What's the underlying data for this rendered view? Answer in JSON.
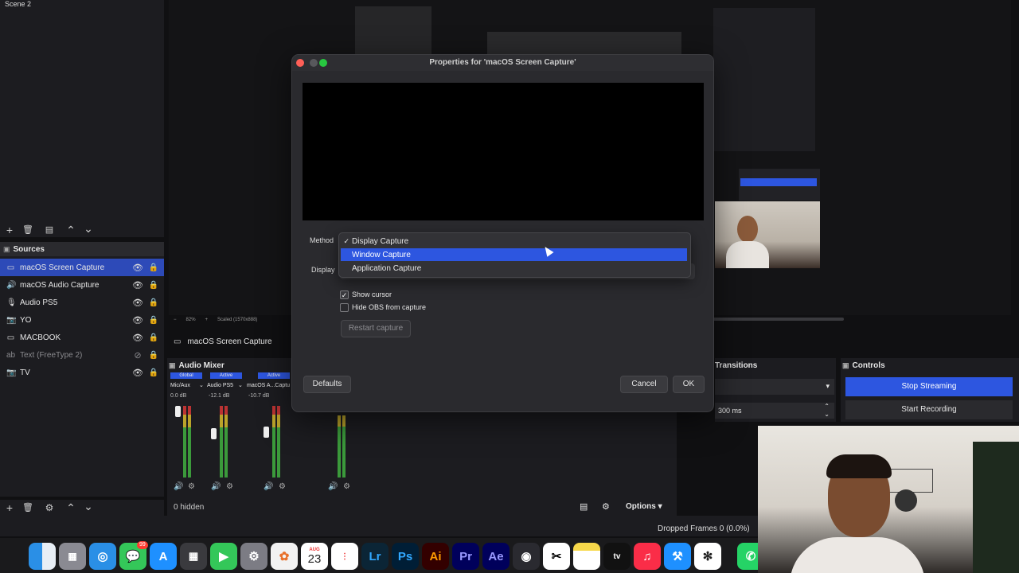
{
  "obs": {
    "scene_label": "Scene 2",
    "sources_title": "Sources",
    "sources": [
      {
        "label": "macOS Screen Capture",
        "icon": "monitor-icon",
        "selected": true
      },
      {
        "label": "macOS Audio Capture",
        "icon": "speaker-icon"
      },
      {
        "label": "Audio PS5",
        "icon": "mic-icon"
      },
      {
        "label": "YO",
        "icon": "camera-icon"
      },
      {
        "label": "MACBOOK",
        "icon": "monitor-icon"
      },
      {
        "label": "Text (FreeType 2)",
        "icon": "text-icon",
        "hidden": true
      },
      {
        "label": "TV",
        "icon": "camera-icon"
      }
    ],
    "preview_zoom": "82%",
    "preview_scale": "Scaled (1570x888)",
    "source_bar_label": "macOS Screen Capture",
    "audio_mixer_title": "Audio Mixer",
    "mixer_channels": [
      {
        "badge": "Global",
        "name": "Mic/Aux",
        "db": "0.0 dB"
      },
      {
        "badge": "Active",
        "name": "Audio PS5",
        "db": "-12.1 dB"
      },
      {
        "badge": "Active",
        "name": "macOS A...Captu",
        "db": "-10.7 dB"
      }
    ],
    "hidden_count": "0 hidden",
    "options_label": "Options",
    "transitions_title": "Transitions",
    "transition_duration": "300 ms",
    "controls_title": "Controls",
    "stop_streaming_label": "Stop Streaming",
    "start_recording_label": "Start Recording",
    "status_dropped_frames": "Dropped Frames 0 (0.0%)"
  },
  "dialog": {
    "title": "Properties for 'macOS Screen Capture'",
    "method_label": "Method",
    "display_label": "Display",
    "menu_items": [
      {
        "label": "Display Capture",
        "checked": true
      },
      {
        "label": "Window Capture",
        "highlighted": true
      },
      {
        "label": "Application Capture"
      }
    ],
    "show_cursor_label": "Show cursor",
    "show_cursor_checked": true,
    "hide_obs_label": "Hide OBS from capture",
    "hide_obs_checked": false,
    "restart_capture_label": "Restart capture",
    "defaults_label": "Defaults",
    "cancel_label": "Cancel",
    "ok_label": "OK"
  },
  "dock": {
    "calendar_month": "AUG",
    "calendar_day": "23",
    "apps": [
      "Finder",
      "Launchpad",
      "Safari",
      "Messages",
      "App Store",
      "Calculator",
      "FaceTime",
      "System Settings",
      "Photos",
      "Calendar",
      "Reminders",
      "Lightroom",
      "Photoshop",
      "Illustrator",
      "Premiere Pro",
      "After Effects",
      "DaVinci Resolve",
      "CapCut",
      "Notes",
      "Apple TV",
      "Music",
      "Xcode",
      "ChatGPT",
      "WhatsApp"
    ],
    "app_letters": {
      "lightroom": "Lr",
      "photoshop": "Ps",
      "illustrator": "Ai",
      "premiere": "Pr",
      "after_effects": "Ae"
    },
    "messages_badge": "99"
  }
}
